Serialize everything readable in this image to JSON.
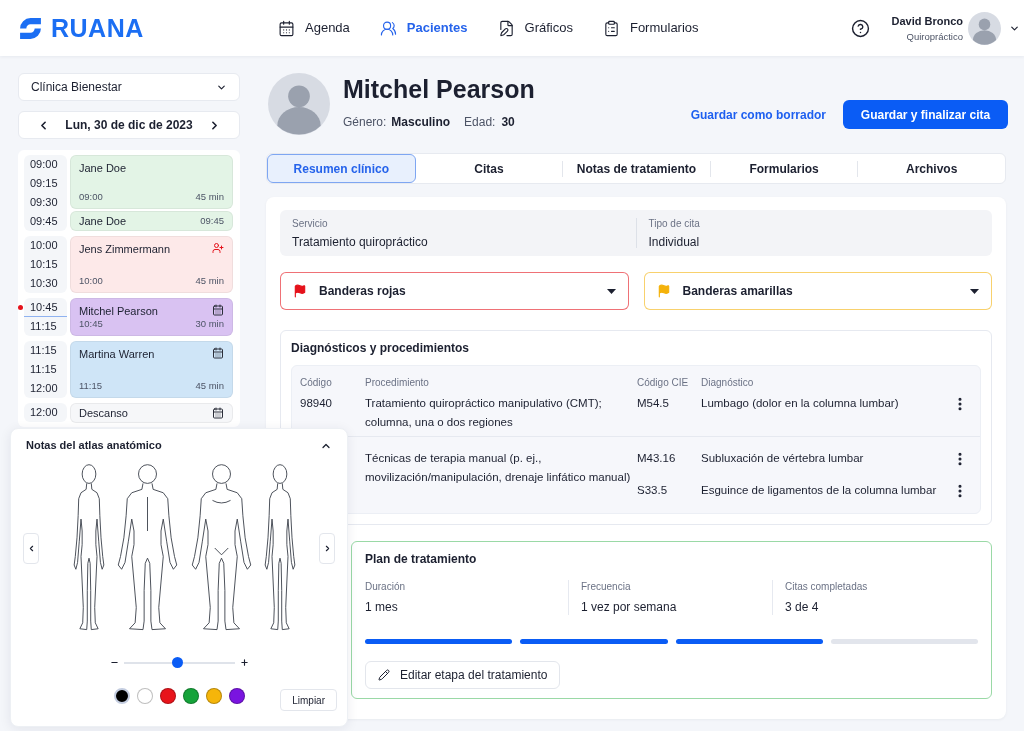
{
  "header": {
    "logo": "RUANA",
    "nav": [
      {
        "label": "Agenda",
        "selected": false
      },
      {
        "label": "Pacientes",
        "selected": true
      },
      {
        "label": "Gráficos",
        "selected": false
      },
      {
        "label": "Formularios",
        "selected": false
      }
    ],
    "user": {
      "name": "David Bronco",
      "role": "Quiropráctico"
    }
  },
  "sidebar": {
    "clinic": "Clínica Bienestar",
    "date": "Lun, 30 de dic de 2023",
    "schedule": [
      {
        "times": [
          {
            "label": "09:00",
            "current": false
          },
          {
            "label": "09:15",
            "current": false
          },
          {
            "label": "09:30",
            "current": false
          },
          {
            "label": "09:45",
            "current": false
          }
        ],
        "appointments": [
          {
            "kind": "full",
            "name": "Jane Doe",
            "time": "09:00",
            "duration": "45 min",
            "new_patient": false,
            "booked": false,
            "color": "#e3f4e6"
          },
          {
            "kind": "inline",
            "name": "Jane Doe",
            "time": "09:45",
            "new_patient": false,
            "booked": false,
            "color": "#e3f4e6"
          }
        ]
      },
      {
        "times": [
          {
            "label": "10:00",
            "current": false
          },
          {
            "label": "10:15",
            "current": false
          },
          {
            "label": "10:30",
            "current": false
          }
        ],
        "appointments": [
          {
            "kind": "full",
            "name": "Jens Zimmermann",
            "time": "10:00",
            "duration": "45 min",
            "new_patient": true,
            "booked": false,
            "color": "#fde9e9"
          }
        ]
      },
      {
        "times": [
          {
            "label": "10:45",
            "current": true
          },
          {
            "label": "11:15",
            "current": false
          }
        ],
        "appointments": [
          {
            "kind": "full",
            "name": "Mitchel Pearson",
            "time": "10:45",
            "duration": "30 min",
            "new_patient": false,
            "booked": true,
            "color": "#d9c2f2"
          }
        ]
      },
      {
        "times": [
          {
            "label": "11:15",
            "current": false
          },
          {
            "label": "11:15",
            "current": false
          },
          {
            "label": "12:00",
            "current": false
          }
        ],
        "appointments": [
          {
            "kind": "full",
            "name": "Martina Warren",
            "time": "11:15",
            "duration": "45 min",
            "new_patient": false,
            "booked": true,
            "color": "#cfe5f7"
          }
        ]
      },
      {
        "times": [
          {
            "label": "12:00",
            "current": false
          }
        ],
        "appointments": [
          {
            "kind": "inline",
            "name": "Descanso",
            "new_patient": false,
            "booked": true,
            "color": "#f6f7f9"
          }
        ]
      }
    ]
  },
  "atlas": {
    "title": "Notas del atlas anatómico",
    "expanded": true,
    "zoom": {
      "level": 0.48
    },
    "colors": [
      {
        "color": "#000000",
        "selected": true
      },
      {
        "color": "#ffffff",
        "selected": false
      },
      {
        "color": "#e8141b",
        "selected": false
      },
      {
        "color": "#15a33a",
        "selected": false
      },
      {
        "color": "#f5b50a",
        "selected": false
      },
      {
        "color": "#7a14e0",
        "selected": false
      }
    ],
    "clear_button": "Limpiar"
  },
  "patient": {
    "name": "Mitchel Pearson",
    "gender_label": "Género:",
    "gender": "Masculino",
    "age_label": "Edad:",
    "age": "30"
  },
  "actions": {
    "draft": "Guardar como borrador",
    "finalize": "Guardar y finalizar cita"
  },
  "tabs": [
    {
      "label": "Resumen clínico",
      "selected": true
    },
    {
      "label": "Citas",
      "selected": false
    },
    {
      "label": "Notas de tratamiento",
      "selected": false
    },
    {
      "label": "Formularios",
      "selected": false
    },
    {
      "label": "Archivos",
      "selected": false
    }
  ],
  "summary": {
    "fields": [
      {
        "label": "Servicio",
        "value": "Tratamiento quiropráctico"
      },
      {
        "label": "Tipo de cita",
        "value": "Individual"
      }
    ],
    "flags": [
      {
        "label": "Banderas rojas",
        "color": "#e5121b"
      },
      {
        "label": "Banderas amarillas",
        "color": "#f4b20b"
      }
    ],
    "diagnoses": {
      "title": "Diagnósticos y procedimientos",
      "columns": [
        "Código",
        "Procedimiento",
        "Código CIE",
        "Diagnóstico"
      ],
      "rows": [
        {
          "code": "98940",
          "procedure": "Tratamiento quiropráctico manipulativo (CMT); columna, una o dos regiones",
          "items": [
            {
              "code": "M54.5",
              "diagnosis": "Lumbago (dolor en la columna lumbar)"
            }
          ]
        },
        {
          "procedure": "Técnicas de terapia manual (p. ej., movilización/manipulación, drenaje linfático manual)",
          "items": [
            {
              "code": "M43.16",
              "diagnosis": "Subluxación de vértebra lumbar"
            },
            {
              "code": "S33.5",
              "diagnosis": "Esguince de ligamentos de la columna lumbar"
            }
          ]
        }
      ]
    },
    "plan": {
      "title": "Plan de tratamiento",
      "stats": [
        {
          "label": "Duración",
          "value": "1 mes"
        },
        {
          "label": "Frecuencia",
          "value": "1 vez por semana"
        },
        {
          "label": "Citas completadas",
          "value": "3 de 4"
        }
      ],
      "segments": [
        {
          "completed": true
        },
        {
          "completed": true
        },
        {
          "completed": true
        },
        {
          "completed": false
        }
      ],
      "edit_button": "Editar etapa del tratamiento"
    }
  }
}
